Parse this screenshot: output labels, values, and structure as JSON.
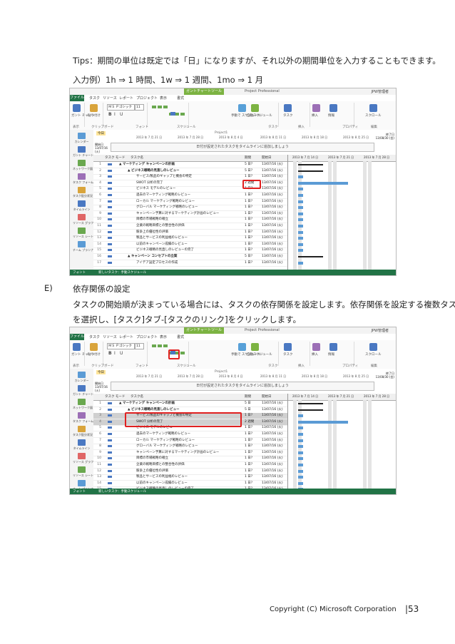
{
  "doc": {
    "tips_line": "Tips：期間の単位は既定では「日」になりますが、それ以外の期間単位を入力することもできます。",
    "example_line": "入力例）1h ⇒ 1 時間、1w ⇒ 1 週間、1mo ⇒ 1 月",
    "section_label": "E)",
    "section_title": "依存関係の設定",
    "body_line1": "タスクの開始順が決まっている場合には、タスクの依存関係を設定します。依存関係を設定する複数タスク",
    "body_line2": "を選択し、[タスク]タブ-[タスクのリンク]をクリックします。",
    "footer": "Copyright (C)   Microsoft Corporation",
    "page_number": "|53"
  },
  "app": {
    "context_tab": "ガントチャートツール",
    "window_title": "Project Professional",
    "user": "JPW管理者",
    "tabs": [
      "ファイル",
      "タスク",
      "リソース",
      "レポート",
      "プロジェクト",
      "表示",
      "書式"
    ],
    "ribbon_buttons": [
      "ガント チャート",
      "貼り付け",
      "スケジュール モード",
      "手動で スケジュール",
      "自動スケジュール",
      "タスク",
      "挿入",
      "情報",
      "スクロール"
    ],
    "ribbon_groups": [
      "表示",
      "クリップボード",
      "フォント",
      "スケジュール",
      "タスク",
      "挿入",
      "プロパティ",
      "編集"
    ],
    "font_name": "ＭＳ Ｐゴシック",
    "font_size": "11",
    "sidebar": [
      "カレンダー",
      "ガント チャート",
      "ネットワーク図",
      "タスク フォーム",
      "タスク配分状況",
      "タイムライン",
      "リソース グラフ",
      "リソース シート",
      "チーム プランナー"
    ],
    "timeline_label": "今日",
    "timeline_start": "開始日 13/07/16 (火)",
    "timeline_end": "終了日 13/08/30 (金)",
    "timeline_ticks": [
      "2013 年 7 月 21 日",
      "2013 年 7 月 28 日",
      "2013 年 8 月 4 日",
      "2013 年 8 月 11 日",
      "2013 年 8 月 18 日",
      "2013 年 8 月 25 日"
    ],
    "timeline_msg": "日付が設定されたタスクをタイムラインに追加しましょう",
    "project_label": "Project1",
    "col_mode": "タスク モード",
    "col_name": "タスク名",
    "col_duration": "期間",
    "col_start": "開始日",
    "gantt_weeks": [
      "2013 年 7 月 14 日",
      "2013 年 7 月 21 日",
      "2013 年 7 月 28 日"
    ],
    "status_left": "フォント",
    "status_mid": "新しいタスク：手動スケジュール"
  },
  "grid1": [
    {
      "n": "1",
      "name": "▲ マーケティング キャンペーンの計画",
      "indent": 0,
      "dur": "5 日?",
      "start": "13/07/16 (火)",
      "bold": true
    },
    {
      "n": "2",
      "name": "▲ ビジネス戦略の見直しのレビュー",
      "indent": 1,
      "dur": "5 日?",
      "start": "13/07/16 (火)",
      "bold": true
    },
    {
      "n": "3",
      "name": "サービス/製品のギャップと機会の特定",
      "indent": 2,
      "dur": "1 日?",
      "start": "13/07/16 (火)",
      "bold": false
    },
    {
      "n": "4",
      "name": "SWOT 分析の完了",
      "indent": 2,
      "dur": "2 週間",
      "start": "13/07/16 (火)",
      "bold": false
    },
    {
      "n": "5",
      "name": "ビジネス モデルのレビュー",
      "indent": 2,
      "dur": "1 日?",
      "start": "13/07/16 (火)",
      "bold": false
    },
    {
      "n": "6",
      "name": "過去のマーケティング戦略のレビュー",
      "indent": 2,
      "dur": "1 日?",
      "start": "13/07/16 (火)",
      "bold": false
    },
    {
      "n": "7",
      "name": "ローカル マーケティング戦略のレビュー",
      "indent": 2,
      "dur": "1 日?",
      "start": "13/07/16 (火)",
      "bold": false
    },
    {
      "n": "8",
      "name": "グローバル マーケティング戦略のレビュー",
      "indent": 2,
      "dur": "1 日?",
      "start": "13/07/16 (火)",
      "bold": false
    },
    {
      "n": "9",
      "name": "キャンペーン予算に対するマーケティング計画のレビュー",
      "indent": 2,
      "dur": "1 日?",
      "start": "13/07/16 (火)",
      "bold": false
    },
    {
      "n": "10",
      "name": "目標の市場戦略の確立",
      "indent": 2,
      "dur": "1 日?",
      "start": "13/07/16 (火)",
      "bold": false
    },
    {
      "n": "11",
      "name": "企業の戦略目標との整合性の評価",
      "indent": 2,
      "dur": "1 日?",
      "start": "13/07/16 (火)",
      "bold": false
    },
    {
      "n": "12",
      "name": "競争上の優位性の評価",
      "indent": 2,
      "dur": "1 日?",
      "start": "13/07/16 (火)",
      "bold": false
    },
    {
      "n": "13",
      "name": "製品とサービスの利益幅のレビュー",
      "indent": 2,
      "dur": "1 日?",
      "start": "13/07/16 (火)",
      "bold": false
    },
    {
      "n": "14",
      "name": "以前のキャンペーン成績のレビュー",
      "indent": 2,
      "dur": "1 日?",
      "start": "13/07/16 (火)",
      "bold": false
    },
    {
      "n": "15",
      "name": "ビジネス戦略の見直しのレビューの完了",
      "indent": 2,
      "dur": "1 日?",
      "start": "13/07/16 (火)",
      "bold": false
    },
    {
      "n": "16",
      "name": "▲ キャンペーン コンセプトの立案",
      "indent": 1,
      "dur": "5 日?",
      "start": "13/07/16 (火)",
      "bold": true
    },
    {
      "n": "17",
      "name": "アイデア設定プロセスの作成",
      "indent": 2,
      "dur": "1 日?",
      "start": "13/07/16 (火)",
      "bold": false
    }
  ],
  "grid2": [
    {
      "n": "1",
      "name": "▲ マーケティング キャンペーンの計画",
      "indent": 0,
      "dur": "5 日",
      "start": "13/07/16 (火)",
      "bold": true
    },
    {
      "n": "2",
      "name": "▲ ビジネス戦略の見直しのレビュー",
      "indent": 1,
      "dur": "5 日",
      "start": "13/07/16 (火)",
      "bold": true
    },
    {
      "n": "3",
      "name": "サービス/製品のギャップと機会の特定",
      "indent": 2,
      "dur": "1 日?",
      "start": "13/07/16 (火)",
      "bold": false
    },
    {
      "n": "4",
      "name": "SWOT 分析の完了",
      "indent": 2,
      "dur": "2 週間",
      "start": "13/07/16 (火)",
      "bold": false
    },
    {
      "n": "5",
      "name": "ビジネス モデルのレビュー",
      "indent": 2,
      "dur": "1 日?",
      "start": "13/07/16 (火)",
      "bold": false
    },
    {
      "n": "6",
      "name": "過去のマーケティング戦略のレビュー",
      "indent": 2,
      "dur": "1 日?",
      "start": "13/07/16 (火)",
      "bold": false
    },
    {
      "n": "7",
      "name": "ローカル マーケティング戦略のレビュー",
      "indent": 2,
      "dur": "1 日?",
      "start": "13/07/16 (火)",
      "bold": false
    },
    {
      "n": "8",
      "name": "グローバル マーケティング戦略のレビュー",
      "indent": 2,
      "dur": "1 日?",
      "start": "13/07/16 (火)",
      "bold": false
    },
    {
      "n": "9",
      "name": "キャンペーン予算に対するマーケティング計画のレビュー",
      "indent": 2,
      "dur": "1 日?",
      "start": "13/07/16 (火)",
      "bold": false
    },
    {
      "n": "10",
      "name": "目標の市場戦略の確立",
      "indent": 2,
      "dur": "1 日?",
      "start": "13/07/16 (火)",
      "bold": false
    },
    {
      "n": "11",
      "name": "企業の戦略目標との整合性の評価",
      "indent": 2,
      "dur": "1 日?",
      "start": "13/07/16 (火)",
      "bold": false
    },
    {
      "n": "12",
      "name": "競争上の優位性の評価",
      "indent": 2,
      "dur": "1 日?",
      "start": "13/07/16 (火)",
      "bold": false
    },
    {
      "n": "13",
      "name": "製品とサービスの利益幅のレビュー",
      "indent": 2,
      "dur": "1 日?",
      "start": "13/07/16 (火)",
      "bold": false
    },
    {
      "n": "14",
      "name": "以前のキャンペーン成績のレビュー",
      "indent": 2,
      "dur": "1 日?",
      "start": "13/07/16 (火)",
      "bold": false
    },
    {
      "n": "15",
      "name": "ビジネス戦略の見直しのレビューの完了",
      "indent": 2,
      "dur": "1 日?",
      "start": "13/07/16 (火)",
      "bold": false
    },
    {
      "n": "16",
      "name": "▲ キャンペーン コンセプトの立案",
      "indent": 1,
      "dur": "5 日",
      "start": "13/07/16 (火)",
      "bold": true
    },
    {
      "n": "17",
      "name": "アイデア設定プロセスの作成",
      "indent": 2,
      "dur": "1 日?",
      "start": "13/07/16 (火)",
      "bold": false
    }
  ],
  "gantt1": [
    {
      "row": 1,
      "type": "summary",
      "start": 0,
      "days": 5
    },
    {
      "row": 2,
      "type": "summary",
      "start": 0,
      "days": 5
    },
    {
      "row": 3,
      "type": "task",
      "start": 0,
      "days": 1
    },
    {
      "row": 4,
      "type": "task",
      "start": 0,
      "days": 10
    },
    {
      "row": 5,
      "type": "task",
      "start": 0,
      "days": 1
    },
    {
      "row": 6,
      "type": "task",
      "start": 0,
      "days": 1
    },
    {
      "row": 7,
      "type": "task",
      "start": 0,
      "days": 1
    },
    {
      "row": 8,
      "type": "task",
      "start": 0,
      "days": 1
    },
    {
      "row": 9,
      "type": "task",
      "start": 0,
      "days": 1
    },
    {
      "row": 10,
      "type": "task",
      "start": 0,
      "days": 1
    },
    {
      "row": 11,
      "type": "task",
      "start": 0,
      "days": 1
    },
    {
      "row": 12,
      "type": "task",
      "start": 0,
      "days": 1
    },
    {
      "row": 13,
      "type": "task",
      "start": 0,
      "days": 1
    },
    {
      "row": 14,
      "type": "task",
      "start": 0,
      "days": 1
    },
    {
      "row": 15,
      "type": "task",
      "start": 0,
      "days": 1
    },
    {
      "row": 16,
      "type": "summary",
      "start": 0,
      "days": 5
    },
    {
      "row": 17,
      "type": "task",
      "start": 0,
      "days": 1
    }
  ],
  "gantt2": [
    {
      "row": 1,
      "type": "summary",
      "start": 0,
      "days": 5
    },
    {
      "row": 2,
      "type": "summary",
      "start": 0,
      "days": 5
    },
    {
      "row": 3,
      "type": "task",
      "start": 0,
      "days": 1
    },
    {
      "row": 4,
      "type": "task",
      "start": 0,
      "days": 10
    },
    {
      "row": 5,
      "type": "task",
      "start": 0,
      "days": 1
    },
    {
      "row": 6,
      "type": "task",
      "start": 0,
      "days": 1
    },
    {
      "row": 7,
      "type": "task",
      "start": 0,
      "days": 1
    },
    {
      "row": 8,
      "type": "task",
      "start": 0,
      "days": 1
    },
    {
      "row": 9,
      "type": "task",
      "start": 0,
      "days": 1
    },
    {
      "row": 10,
      "type": "task",
      "start": 0,
      "days": 1
    },
    {
      "row": 11,
      "type": "task",
      "start": 0,
      "days": 1
    },
    {
      "row": 12,
      "type": "task",
      "start": 0,
      "days": 1
    },
    {
      "row": 13,
      "type": "task",
      "start": 0,
      "days": 1
    },
    {
      "row": 14,
      "type": "task",
      "start": 0,
      "days": 1
    },
    {
      "row": 15,
      "type": "task",
      "start": 0,
      "days": 1
    },
    {
      "row": 16,
      "type": "summary",
      "start": 0,
      "days": 5
    },
    {
      "row": 17,
      "type": "task",
      "start": 0,
      "days": 1
    }
  ],
  "colors": {
    "accent": "#217346",
    "context": "#7cb342",
    "highlight": "#e02020",
    "bar": "#5b9bd5"
  }
}
